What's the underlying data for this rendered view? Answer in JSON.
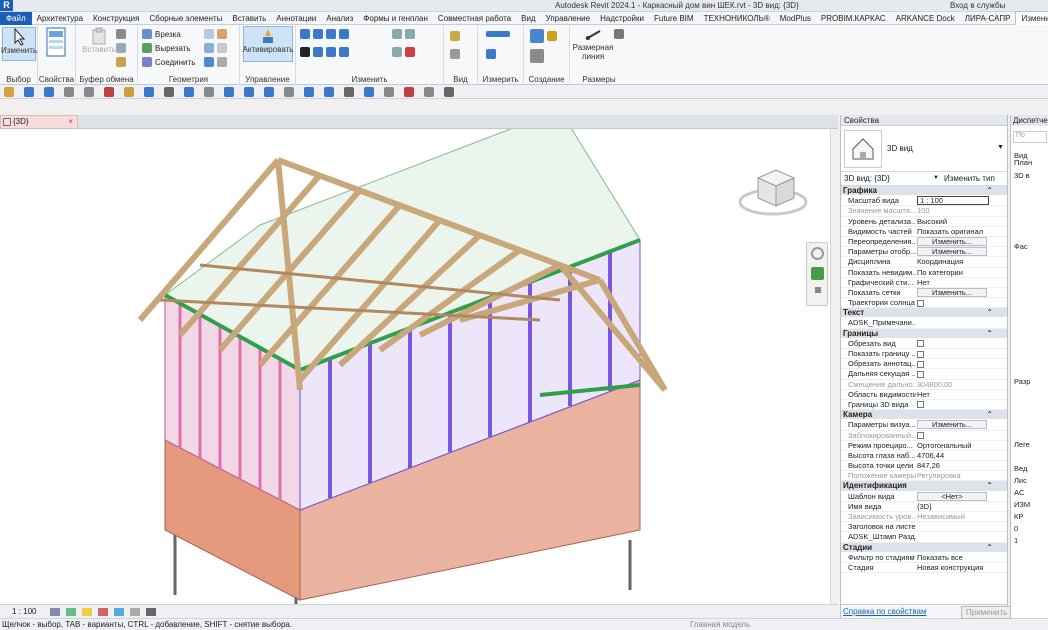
{
  "titlebar": {
    "logo": "R",
    "title": "Autodesk Revit 2024.1 - Каркасный дом вин ШЕК.rvt - 3D вид: {3D}",
    "signin": "Вход в службы"
  },
  "menu": [
    "Файл",
    "Архитектура",
    "Конструкция",
    "Сборные элементы",
    "Вставить",
    "Аннотации",
    "Анализ",
    "Формы и генплан",
    "Совместная работа",
    "Вид",
    "Управление",
    "Надстройки",
    "Future BIM",
    "ТЕХНОНИКОЛЬ®",
    "ModPlus",
    "PROBIM.КАРКАС",
    "ARKANCE Dock",
    "ЛИРА-САПР",
    "Изменить"
  ],
  "ribbon": {
    "modify": "Изменить",
    "select_label": "Выбор",
    "properties_label": "Свойства",
    "clipboard": {
      "paste": "Вставить",
      "label": "Буфер обмена"
    },
    "geometry": {
      "cut": "Врезка",
      "cut_out": "Вырезать",
      "join": "Соединить",
      "label": "Геометрия"
    },
    "control": {
      "activate": "Активировать",
      "label": "Управление"
    },
    "modify_label": "Изменить",
    "view_label": "Вид",
    "measure_label": "Измерить",
    "create_label": "Создание",
    "dims": {
      "dim_line": "Размерная линия",
      "label": "Размеры"
    }
  },
  "view_tab": {
    "label": "{3D}"
  },
  "view_control": {
    "scale": "1 : 100"
  },
  "status": {
    "hint": "Щелчок - выбор, TAB - варианты, CTRL - добавление, SHIFT - снятие выбора.",
    "model": "Главная модель"
  },
  "properties": {
    "title": "Свойства",
    "type_name": "3D вид",
    "instance": "3D вид: {3D}",
    "edit_type": "Изменить тип",
    "categories": [
      {
        "name": "Графика",
        "rows": [
          {
            "k": "Масштаб вида",
            "v": "1 : 100",
            "kind": "input"
          },
          {
            "k": "Значение масшта...",
            "v": "100",
            "kind": "dis"
          },
          {
            "k": "Уровень детализа...",
            "v": "Высокий"
          },
          {
            "k": "Видимость частей",
            "v": "Показать оригинал"
          },
          {
            "k": "Переопределения...",
            "v": "Изменить...",
            "kind": "btn"
          },
          {
            "k": "Параметры отобр...",
            "v": "Изменить...",
            "kind": "btn"
          },
          {
            "k": "Дисциплина",
            "v": "Координация"
          },
          {
            "k": "Показать невидим...",
            "v": "По категории"
          },
          {
            "k": "Графический сти...",
            "v": "Нет"
          },
          {
            "k": "Показать сетки",
            "v": "Изменить...",
            "kind": "btn"
          },
          {
            "k": "Траектория солнца",
            "v": "",
            "kind": "cb"
          }
        ]
      },
      {
        "name": "Текст",
        "rows": [
          {
            "k": "ADSK_Примечани...",
            "v": ""
          }
        ]
      },
      {
        "name": "Границы",
        "rows": [
          {
            "k": "Обрезать вид",
            "v": "",
            "kind": "cb"
          },
          {
            "k": "Показать границу ...",
            "v": "",
            "kind": "cb"
          },
          {
            "k": "Обрезать аннотац...",
            "v": "",
            "kind": "cb"
          },
          {
            "k": "Дальняя секущая ...",
            "v": "",
            "kind": "cb"
          },
          {
            "k": "Смещение дально...",
            "v": "304800,00",
            "kind": "dis"
          },
          {
            "k": "Область видимости",
            "v": "Нет"
          },
          {
            "k": "Границы 3D вида",
            "v": "",
            "kind": "cb"
          }
        ]
      },
      {
        "name": "Камера",
        "rows": [
          {
            "k": "Параметры визуа...",
            "v": "Изменить...",
            "kind": "btn"
          },
          {
            "k": "Заблокированный...",
            "v": "",
            "kind": "discb"
          },
          {
            "k": "Режим проециро...",
            "v": "Ортогональный"
          },
          {
            "k": "Высота глаза наб...",
            "v": "4706,44"
          },
          {
            "k": "Высота точки цели",
            "v": "847,26"
          },
          {
            "k": "Положение камеры",
            "v": "Регулировка",
            "kind": "dis"
          }
        ]
      },
      {
        "name": "Идентификация",
        "rows": [
          {
            "k": "Шаблон вида",
            "v": "<Нет>",
            "kind": "btn"
          },
          {
            "k": "Имя вида",
            "v": "{3D}"
          },
          {
            "k": "Зависимость уров...",
            "v": "Независимый",
            "kind": "dis"
          },
          {
            "k": "Заголовок на листе",
            "v": ""
          },
          {
            "k": "ADSK_Штамп Разд...",
            "v": ""
          }
        ]
      },
      {
        "name": "Стадии",
        "rows": [
          {
            "k": "Фильтр по стадиям",
            "v": "Показать все"
          },
          {
            "k": "Стадия",
            "v": "Новая конструкция"
          }
        ]
      }
    ],
    "help_link": "Справка по свойствам",
    "apply": "Применить"
  },
  "project_browser": {
    "title": "Диспетчер",
    "search_placeholder": "По",
    "items": [
      "Вид",
      "План",
      "3D в",
      "Фас",
      "Разр",
      "Леге",
      "Вед",
      "Лис",
      "AC",
      "ИЗМ",
      "КР",
      "0",
      "1"
    ]
  },
  "colors": {
    "accent": "#1d5fb8",
    "timber": "#c8a77a",
    "purple": "#6f4fd8",
    "pink": "#e06fa8",
    "green": "#2f8f4a",
    "salmon": "#e8a08c"
  }
}
